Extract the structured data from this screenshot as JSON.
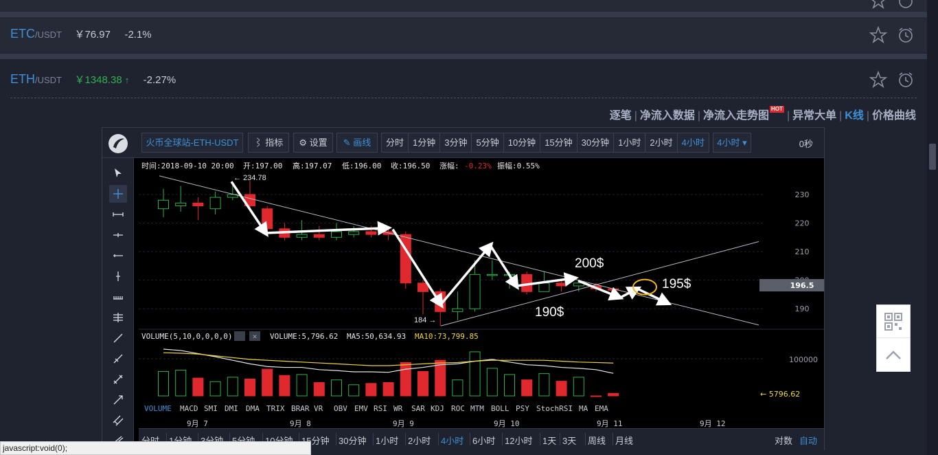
{
  "pairs": [
    {
      "symbol": "ETC",
      "quote": "/USDT",
      "price": "￥76.97",
      "change": "-2.1%",
      "arrow": ""
    },
    {
      "symbol": "ETH",
      "quote": "/USDT",
      "price": "￥1348.38",
      "change": "-2.27%",
      "arrow": "↑"
    }
  ],
  "links": {
    "items": [
      "逐笔",
      "净流入数据",
      "净流入走势图",
      "异常大单",
      "K线",
      "价格曲线"
    ],
    "hot": "HOT",
    "active": "K线"
  },
  "toolbar": {
    "market": "火币全球站-ETH-USDT",
    "indicator": "指标",
    "settings": "设置",
    "draw": "画线",
    "intervals": [
      "分时",
      "1分钟",
      "3分钟",
      "5分钟",
      "10分钟",
      "15分钟",
      "30分钟",
      "1小时",
      "2小时",
      "4小时"
    ],
    "selected_interval": "4小时",
    "dropdown": "4小时",
    "countdown": "0秒"
  },
  "info_bar": {
    "time": "时间:2018-09-10 20:00",
    "open": "开:197.00",
    "high": "高:197.07",
    "low": "低:196.00",
    "close": "收:196.50",
    "change_label": "涨幅:",
    "change_value": "-0.23%",
    "amplitude": "振幅:0.55%"
  },
  "volume_bar": {
    "label": "VOLUME(5,10,0,0,0,0)",
    "volume": "VOLUME:5,796.62",
    "ma5": "MA5:50,634.93",
    "ma10": "MA10:73,799.85"
  },
  "price_axis": [
    "230",
    "220",
    "210",
    "200",
    "190"
  ],
  "current_price": "196.5",
  "volume_axis": "100000",
  "volume_current": "← 5796.62",
  "annotations": {
    "high": "← 234.78",
    "low": "184 →",
    "p200": "200$",
    "p190": "190$",
    "p195": "195$"
  },
  "indicators": [
    "VOLUME",
    "MACD",
    "SMI",
    "DMI",
    "DMA",
    "TRIX",
    "BRAR",
    "VR",
    "OBV",
    "EMV",
    "RSI",
    "WR",
    "SAR",
    "KDJ",
    "ROC",
    "MTM",
    "BOLL",
    "PSY",
    "StochRSI",
    "MA",
    "EMA"
  ],
  "selected_indicator": "VOLUME",
  "dates": [
    "9月 7",
    "9月 8",
    "9月 9",
    "9月 10",
    "9月 11",
    "9月 12"
  ],
  "bottom_tabs": [
    "分时",
    "1分钟",
    "3分钟",
    "5分钟",
    "10分钟",
    "15分钟",
    "30分钟",
    "1小时",
    "2小时",
    "4小时",
    "6小时",
    "12小时",
    "1天",
    "3天",
    "周线",
    "月线"
  ],
  "bottom_selected": "4小时",
  "bottom_right": [
    "对数",
    "自动"
  ],
  "status": "javascript:void(0);",
  "chart_data": {
    "type": "candlestick",
    "ylim": [
      180,
      240
    ],
    "candles": [
      {
        "o": 225,
        "c": 228,
        "h": 232,
        "l": 222
      },
      {
        "o": 226,
        "c": 227,
        "h": 233,
        "l": 224
      },
      {
        "o": 227,
        "c": 226,
        "h": 229,
        "l": 221
      },
      {
        "o": 225,
        "c": 229,
        "h": 231,
        "l": 223
      },
      {
        "o": 229,
        "c": 230,
        "h": 234,
        "l": 228
      },
      {
        "o": 230,
        "c": 226,
        "h": 234.78,
        "l": 225
      },
      {
        "o": 225,
        "c": 218,
        "h": 226,
        "l": 216
      },
      {
        "o": 218,
        "c": 215,
        "h": 220,
        "l": 214
      },
      {
        "o": 215,
        "c": 216,
        "h": 221,
        "l": 214
      },
      {
        "o": 216,
        "c": 215,
        "h": 219,
        "l": 214
      },
      {
        "o": 215,
        "c": 217,
        "h": 220,
        "l": 214
      },
      {
        "o": 216,
        "c": 217,
        "h": 219,
        "l": 215
      },
      {
        "o": 217,
        "c": 216,
        "h": 219,
        "l": 215
      },
      {
        "o": 217,
        "c": 216,
        "h": 218,
        "l": 214
      },
      {
        "o": 216,
        "c": 199,
        "h": 217,
        "l": 197
      },
      {
        "o": 199,
        "c": 196,
        "h": 200,
        "l": 188
      },
      {
        "o": 196,
        "c": 189,
        "h": 197,
        "l": 184
      },
      {
        "o": 189,
        "c": 190,
        "h": 196,
        "l": 186
      },
      {
        "o": 190,
        "c": 202,
        "h": 207,
        "l": 189
      },
      {
        "o": 202,
        "c": 202,
        "h": 207,
        "l": 200
      },
      {
        "o": 202,
        "c": 202,
        "h": 203,
        "l": 197
      },
      {
        "o": 202,
        "c": 196,
        "h": 203,
        "l": 195
      },
      {
        "o": 196,
        "c": 199,
        "h": 203,
        "l": 196
      },
      {
        "o": 199,
        "c": 198,
        "h": 200,
        "l": 196
      },
      {
        "o": 198,
        "c": 199,
        "h": 200,
        "l": 196
      },
      {
        "o": 198,
        "c": 197,
        "h": 199,
        "l": 196
      },
      {
        "o": 197,
        "c": 196.5,
        "h": 197.07,
        "l": 196
      }
    ],
    "volume": [
      55000,
      58000,
      40000,
      32000,
      42000,
      38000,
      60000,
      46000,
      48000,
      30000,
      36000,
      25000,
      28000,
      30000,
      75000,
      55000,
      80000,
      36000,
      99000,
      62000,
      48000,
      36000,
      50000,
      33000,
      42000,
      0,
      5796.62
    ],
    "volume_ylim": [
      0,
      120000
    ],
    "ma5": [
      105000,
      102000,
      95000,
      88000,
      80000,
      72000,
      66000,
      64000,
      64000,
      59000,
      57000,
      54000,
      54000,
      53000,
      60000,
      64000,
      70000,
      72000,
      78000,
      82000,
      76000,
      70000,
      68000,
      64000,
      62000,
      59000,
      50634.93
    ],
    "ma10": [
      97000,
      96000,
      94000,
      90000,
      86000,
      82000,
      80000,
      78000,
      76000,
      74000,
      72000,
      70000,
      68000,
      68000,
      70000,
      72000,
      74000,
      75000,
      78000,
      80000,
      80000,
      80000,
      80000,
      78000,
      76000,
      75000,
      73799.85
    ]
  }
}
